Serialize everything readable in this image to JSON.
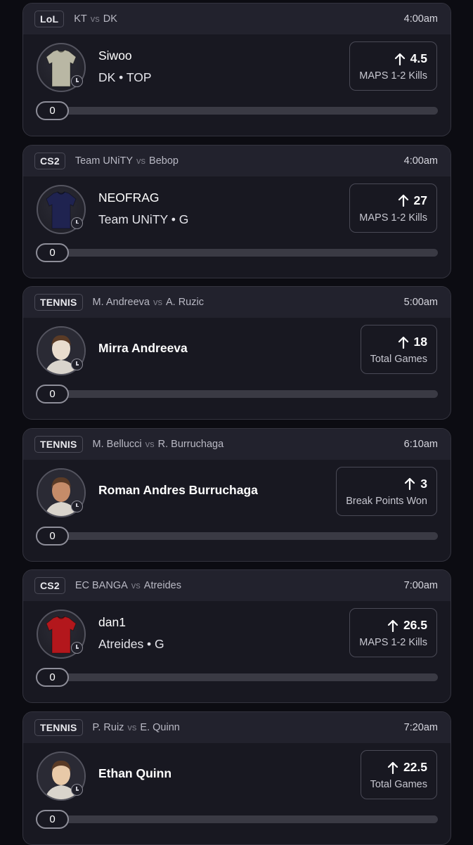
{
  "cards": [
    {
      "league": "LoL",
      "team_a": "KT",
      "vs": "vs",
      "team_b": "DK",
      "time": "4:00am",
      "player_name": "Siwoo",
      "player_team": "DK • TOP",
      "stat_value": "4.5",
      "stat_label": "MAPS 1-2 Kills",
      "direction_icon": "arrow-up-icon",
      "progress_value": "0",
      "avatar": "jersey-icon",
      "jersey_color": "#b9b7a4"
    },
    {
      "league": "CS2",
      "team_a": "Team UNiTY",
      "vs": "vs",
      "team_b": "Bebop",
      "time": "4:00am",
      "player_name": "NEOFRAG",
      "player_team": "Team UNiTY • G",
      "stat_value": "27",
      "stat_label": "MAPS 1-2 Kills",
      "direction_icon": "arrow-up-icon",
      "progress_value": "0",
      "avatar": "jersey-icon",
      "jersey_color": "#1f2350"
    },
    {
      "league": "TENNIS",
      "team_a": "M. Andreeva",
      "vs": "vs",
      "team_b": "A. Ruzic",
      "time": "5:00am",
      "player_name": "Mirra Andreeva",
      "player_team": "",
      "stat_value": "18",
      "stat_label": "Total Games",
      "direction_icon": "arrow-up-icon",
      "progress_value": "0",
      "avatar": "player-headshot",
      "jersey_color": "#e9dccd"
    },
    {
      "league": "TENNIS",
      "team_a": "M. Bellucci",
      "vs": "vs",
      "team_b": "R. Burruchaga",
      "time": "6:10am",
      "player_name": "Roman Andres Burruchaga",
      "player_team": "",
      "stat_value": "3",
      "stat_label": "Break Points Won",
      "direction_icon": "arrow-up-icon",
      "progress_value": "0",
      "avatar": "player-headshot",
      "jersey_color": "#c58c69"
    },
    {
      "league": "CS2",
      "team_a": "EC BANGA",
      "vs": "vs",
      "team_b": "Atreides",
      "time": "7:00am",
      "player_name": "dan1",
      "player_team": "Atreides • G",
      "stat_value": "26.5",
      "stat_label": "MAPS 1-2 Kills",
      "direction_icon": "arrow-up-icon",
      "progress_value": "0",
      "avatar": "jersey-icon",
      "jersey_color": "#b3171c"
    },
    {
      "league": "TENNIS",
      "team_a": "P. Ruiz",
      "vs": "vs",
      "team_b": "E. Quinn",
      "time": "7:20am",
      "player_name": "Ethan Quinn",
      "player_team": "",
      "stat_value": "22.5",
      "stat_label": "Total Games",
      "direction_icon": "arrow-up-icon",
      "progress_value": "0",
      "avatar": "player-headshot",
      "jersey_color": "#e8c9a8"
    }
  ]
}
